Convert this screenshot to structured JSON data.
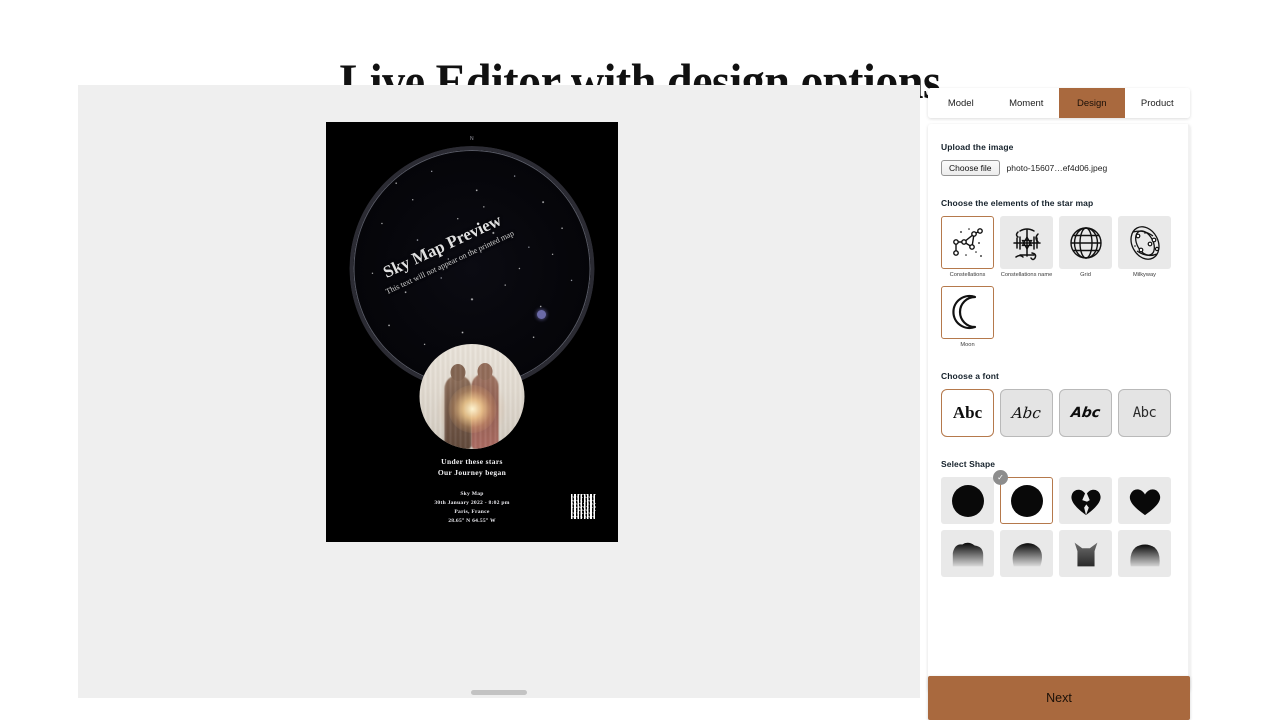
{
  "page": {
    "title": "Live Editor with design options"
  },
  "canvas": {
    "scrollbar": "horizontal-scrollbar"
  },
  "poster": {
    "compass_north": "N",
    "watermark_title": "Sky Map Preview",
    "watermark_note": "This text will not appear on the printed map",
    "quote_line1": "Under these stars",
    "quote_line2": "Our Journey began",
    "meta_title": "Sky Map",
    "meta_datetime": "30th January 2022 - 8:02 pm",
    "meta_location": "Paris, France",
    "meta_coords": "28.65° N   64.55° W"
  },
  "panel": {
    "tabs": [
      {
        "label": "Model",
        "active": false
      },
      {
        "label": "Moment",
        "active": false
      },
      {
        "label": "Design",
        "active": true
      },
      {
        "label": "Product",
        "active": false
      }
    ],
    "upload": {
      "section_title": "Upload the image",
      "button_label": "Choose file",
      "file_name": "photo-15607…ef4d06.jpeg"
    },
    "elements": {
      "section_title": "Choose the elements of the star map",
      "items": [
        {
          "label": "Constellations",
          "icon": "constellation-icon",
          "selected": true
        },
        {
          "label": "Constellations name",
          "icon": "zodiac-symbols-icon",
          "selected": false
        },
        {
          "label": "Grid",
          "icon": "grid-globe-icon",
          "selected": false
        },
        {
          "label": "Milkyway",
          "icon": "galaxy-icon",
          "selected": false
        },
        {
          "label": "Moon",
          "icon": "moon-crescent-icon",
          "selected": true
        }
      ]
    },
    "fonts": {
      "section_title": "Choose a font",
      "items": [
        {
          "sample": "Abc",
          "style": "serif-bold",
          "selected": true
        },
        {
          "sample": "Abc",
          "style": "script-italic",
          "selected": false
        },
        {
          "sample": "Abc",
          "style": "brush-italic",
          "selected": false
        },
        {
          "sample": "Abc",
          "style": "handwritten",
          "selected": false
        }
      ]
    },
    "shapes": {
      "section_title": "Select Shape",
      "check_glyph": "✓",
      "items": [
        {
          "name": "circle-solid",
          "selected": false
        },
        {
          "name": "circle-textured",
          "selected": true
        },
        {
          "name": "broken-heart",
          "selected": false
        },
        {
          "name": "heart",
          "selected": false
        },
        {
          "name": "cloud-partial",
          "selected": false
        },
        {
          "name": "blob-partial",
          "selected": false
        },
        {
          "name": "cat-partial",
          "selected": false
        },
        {
          "name": "dog-partial",
          "selected": false
        }
      ]
    },
    "next_button": "Next"
  },
  "colors": {
    "accent_brown": "#a9693e",
    "selected_border": "#b5794c",
    "canvas_bg": "#efefef",
    "tile_bg": "#e9e9e9",
    "poster_bg": "#000000"
  }
}
